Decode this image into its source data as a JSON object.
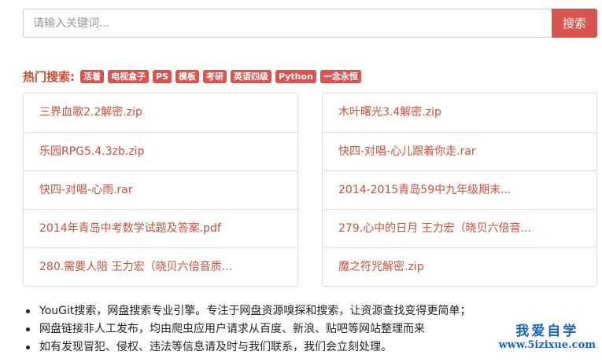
{
  "search": {
    "placeholder": "请输入关键词...",
    "button_label": "搜索"
  },
  "hot": {
    "label": "热门搜索:",
    "tags": [
      "活着",
      "电视盒子",
      "PS",
      "模板",
      "考研",
      "英语四级",
      "Python",
      "一念永恒"
    ]
  },
  "results": {
    "left": [
      "三界血歌2.2解密.zip",
      "乐园RPG5.4.3zb.zip",
      "快四-对唱-心雨.rar",
      "2014年青岛中考数学试题及答案.pdf",
      "280.需要人陪 王力宏（晓贝六倍音质..."
    ],
    "right": [
      "木叶曙光3.4解密.zip",
      "快四-对唱-心儿跟着你走.rar",
      "2014-2015青岛59中九年级期末...",
      "279.心中的日月 王力宏（晓贝六倍音...",
      "魔之符咒解密.zip"
    ]
  },
  "notes": [
    "YouGit搜索，网盘搜索专业引擎。专注于网盘资源嗅探和搜索，让资源查找变得更简单；",
    "网盘链接非人工发布，均由爬虫应用户请求从百度、新浪、贴吧等网站整理而来",
    "如有发现冒犯、侵权、违法等信息请及时与我们联系，我们会立刻处理。"
  ],
  "watermark": {
    "top": "我爱自学",
    "bottom": "www.5izixue.com"
  },
  "colors": {
    "accent": "#d9534f",
    "link": "#c9503c",
    "watermark": "#1565c0"
  }
}
